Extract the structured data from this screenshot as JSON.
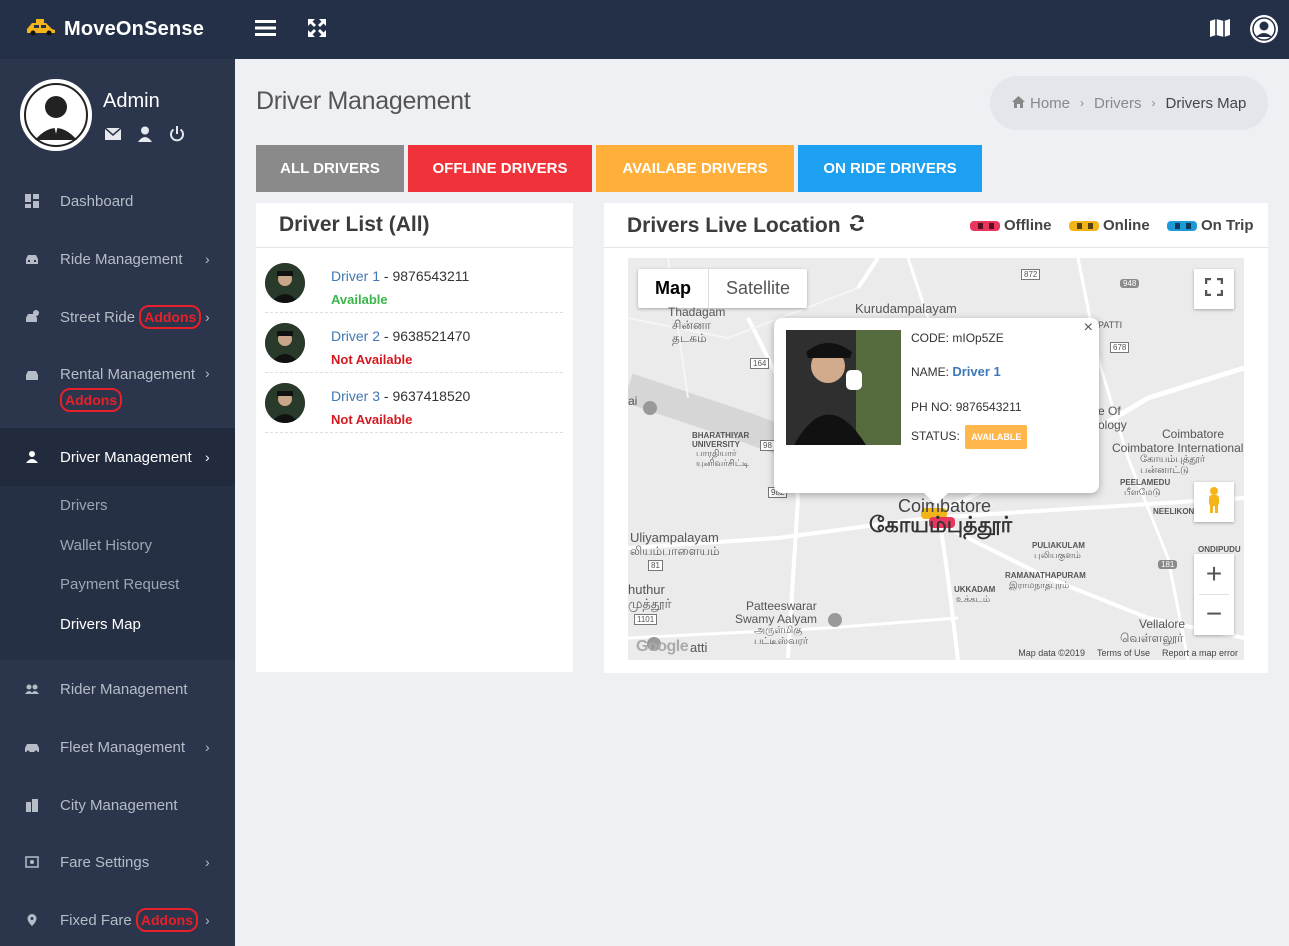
{
  "app": {
    "brand": "MoveOnSense"
  },
  "profile": {
    "name": "Admin"
  },
  "sidebar": {
    "items": [
      {
        "label": "Dashboard"
      },
      {
        "label": "Ride Management"
      },
      {
        "label": "Street Ride",
        "badge": "Addons"
      },
      {
        "label": "Rental Management",
        "badge": "Addons"
      },
      {
        "label": "Driver Management"
      },
      {
        "label": "Rider Management"
      },
      {
        "label": "Fleet Management"
      },
      {
        "label": "City Management"
      },
      {
        "label": "Fare Settings"
      },
      {
        "label": "Fixed Fare",
        "badge": "Addons"
      }
    ],
    "submenu": [
      "Drivers",
      "Wallet History",
      "Payment Request",
      "Drivers Map"
    ]
  },
  "page": {
    "title": "Driver Management"
  },
  "breadcrumb": {
    "home": "Home",
    "section": "Drivers",
    "current": "Drivers Map"
  },
  "tabs": [
    {
      "label": "ALL DRIVERS",
      "color": "#8a8a8a"
    },
    {
      "label": "OFFLINE DRIVERS",
      "color": "#f0323a"
    },
    {
      "label": "AVAILABE DRIVERS",
      "color": "#ffaf3a"
    },
    {
      "label": "ON RIDE DRIVERS",
      "color": "#1da0f2"
    }
  ],
  "driver_list": {
    "title": "Driver List (All)",
    "drivers": [
      {
        "name": "Driver 1",
        "sep": " - ",
        "phone": "9876543211",
        "status": "Available",
        "status_color": "#3ab54a"
      },
      {
        "name": "Driver 2",
        "sep": " - ",
        "phone": "9638521470",
        "status": "Not Available",
        "status_color": "#d31920"
      },
      {
        "name": "Driver 3",
        "sep": " - ",
        "phone": "9637418520",
        "status": "Not Available",
        "status_color": "#d31920"
      }
    ]
  },
  "live_location": {
    "title": "Drivers Live Location",
    "legend": [
      {
        "label": "Offline",
        "color": "#e8365d"
      },
      {
        "label": "Online",
        "color": "#f2b519"
      },
      {
        "label": "On Trip",
        "color": "#1e9ad6"
      }
    ]
  },
  "map": {
    "type_map": "Map",
    "type_satellite": "Satellite",
    "labels": {
      "kurudampalayam": "Kurudampalayam",
      "thadagam": "Thadagam",
      "thadagam_ta": "சின்னா தடகம்",
      "bharathiyar": "BHARATHIYAR UNIVERSITY",
      "bharathiyar_ta": "பாரதியார் யுனிவர்சிட்டி",
      "coimbatore": "Coimbatore",
      "coimbatore_ta": "கோயம்புத்தூர்",
      "uliyampalayam": "Uliyampalayam",
      "uliyampalayam_ta": "லியம்பாளையம்",
      "muthur": "huthur",
      "muthur_ta": "முத்தூர்",
      "patteeswarar": "Patteeswarar",
      "swamy": "Swamy Aalyam",
      "swamy_ta": "அருள்மிகு பட்டீஸ்வரர்",
      "airport": "Coimbatore International Airpo",
      "airport_ta": "கோயம்புத்தூர் பன்னாட்டு",
      "peelamedu": "PEELAMEDU",
      "peelamedu_ta": "பீளமேடு",
      "neelikon": "NEELIKON",
      "puliakulam": "PULIAKULAM",
      "puliakulam_ta": "புலியகுளம்",
      "ramanathapuram": "RAMANATHAPURAM",
      "ramanathapuram_ta": "இராமநாதபுரம்",
      "ukkadam": "UKKADAM",
      "ukkadam_ta": "உக்கடம்",
      "ondipudur": "ONDIPUDU",
      "vellalore": "Vellalore",
      "vellalore_ta": "வெள்ளலூர்",
      "ai": "ai",
      "eof": "e Of",
      "ology": "ology",
      "patti": "PATTI",
      "road_872": "872",
      "road_948": "948",
      "road_678": "678",
      "road_164": "164",
      "road_982": "982",
      "road_81": "81",
      "road_1101": "1101",
      "road_181": "181",
      "road_98": "98"
    },
    "footer": {
      "data": "Map data ©2019",
      "terms": "Terms of Use",
      "report": "Report a map error"
    },
    "google": "Google",
    "tail": "atti"
  },
  "popup": {
    "code_label": "CODE:",
    "code": "mIOp5ZE",
    "name_label": "NAME:",
    "name": "Driver 1",
    "phone_label": "PH NO:",
    "phone": "9876543211",
    "status_label": "STATUS:",
    "status": "AVAILABLE"
  }
}
